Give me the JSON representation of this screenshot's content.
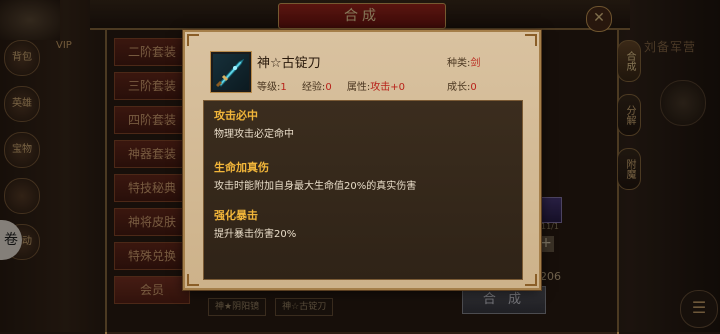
{
  "window": {
    "title": "合成",
    "close_label": "✕"
  },
  "left_menu": {
    "vip_label": "VIP",
    "icons": [
      "背包",
      "英雄",
      "宝物",
      "",
      "活动"
    ],
    "edge_glyph": "卷"
  },
  "side_list": {
    "items": [
      "二阶套装",
      "三阶套装",
      "四阶套装",
      "神器套装",
      "特技秘典",
      "神将皮肤",
      "特殊兑换",
      "会员"
    ]
  },
  "right_panel": {
    "tabs": [
      "合成",
      "分解",
      "附魔"
    ],
    "name": "刘备军营",
    "slot_count": "11/1",
    "quantity": "206",
    "combine_button": "合 成",
    "menu_glyph": "☰"
  },
  "bottom_tags": [
    "神★阴阳镜",
    "神☆古锭刀"
  ],
  "tooltip": {
    "item_name": "神☆古锭刀",
    "type_label": "种类:",
    "type_value": "剑",
    "level_label": "等级:",
    "level_value": "1",
    "exp_label": "经验:",
    "exp_value": "0",
    "attr_label": "属性:",
    "attr_value": "攻击+0",
    "growth_label": "成长:",
    "growth_value": "0",
    "effects": [
      {
        "title": "攻击必中",
        "desc": "物理攻击必定命中"
      },
      {
        "title": "生命加真伤",
        "desc": "攻击时能附加自身最大生命值20%的真实伤害"
      },
      {
        "title": "强化暴击",
        "desc": "提升暴击伤害20%"
      }
    ]
  },
  "colors": {
    "accent_red": "#b8221a",
    "effect_title": "#f2b63a",
    "banner_red": "#a3261d"
  }
}
